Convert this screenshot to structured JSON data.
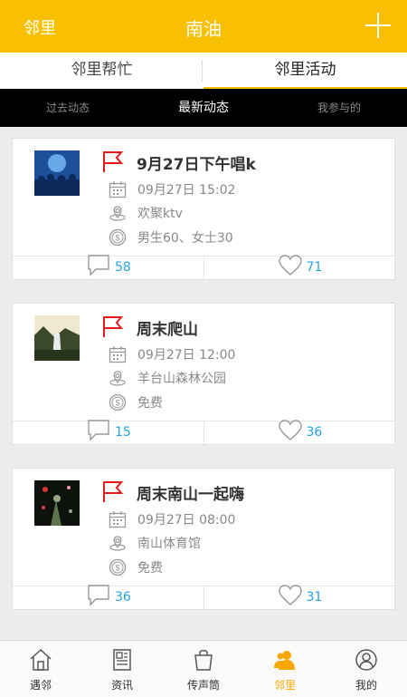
{
  "header": {
    "left": "邻里",
    "title": "南油"
  },
  "tabs1": [
    "邻里帮忙",
    "邻里活动"
  ],
  "tabs2": [
    "过去动态",
    "最新动态",
    "我参与的"
  ],
  "cards": [
    {
      "title": "9月27日下午唱k",
      "date": "09月27日 15:02",
      "place": "欢聚ktv",
      "fee": "男生60、女士30",
      "comments": "58",
      "likes": "71"
    },
    {
      "title": "周末爬山",
      "date": "09月27日 12:00",
      "place": "羊台山森林公园",
      "fee": "免费",
      "comments": "15",
      "likes": "36"
    },
    {
      "title": "周末南山一起嗨",
      "date": "09月27日 08:00",
      "place": "南山体育馆",
      "fee": "免费",
      "comments": "36",
      "likes": "31"
    }
  ],
  "nav": [
    "遇邻",
    "资讯",
    "传声筒",
    "邻里",
    "我的"
  ],
  "colors": {
    "accent": "#f8c000",
    "link": "#26a4e0"
  }
}
